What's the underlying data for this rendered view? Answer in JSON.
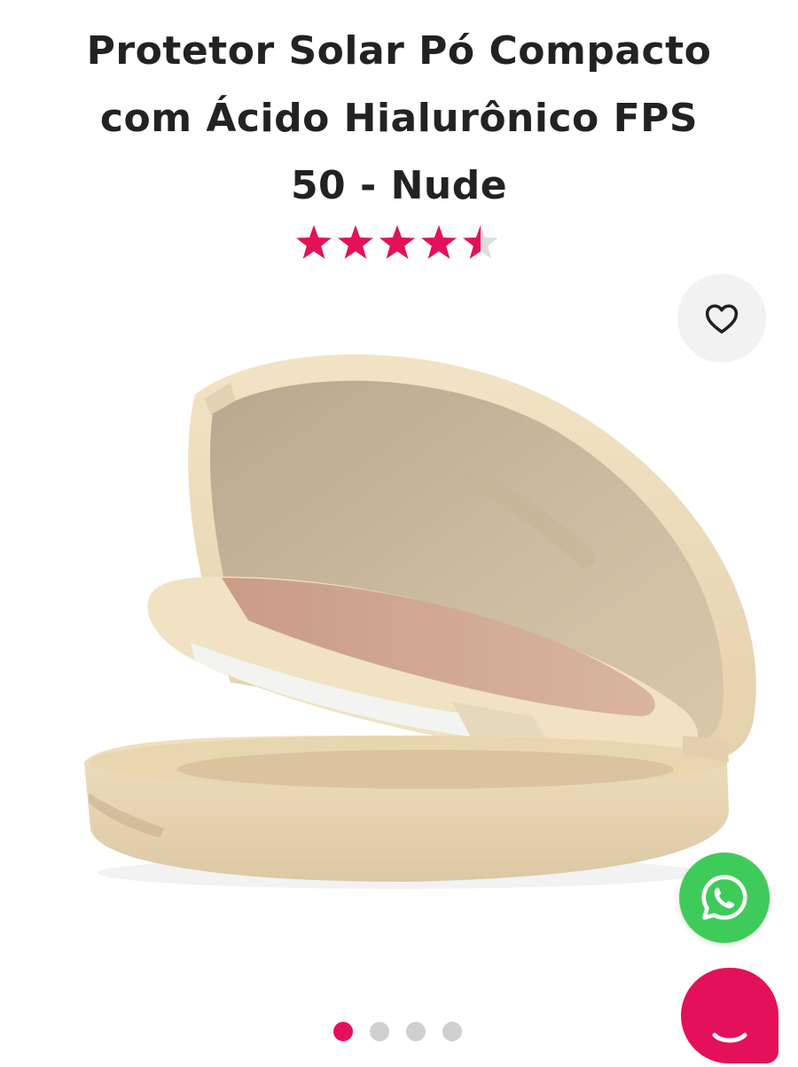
{
  "product": {
    "title_line1": "Protetor Solar Pó Compacto",
    "title_line2": "com Ácido Hialurônico FPS",
    "title_line3": "50 - Nude"
  },
  "rating": {
    "value": 4.5,
    "max": 5,
    "star_color": "#e5105a",
    "empty_color": "#dddddd"
  },
  "icons": {
    "favorite": "heart-outline-icon",
    "whatsapp": "whatsapp-icon",
    "chat": "chat-bubble-icon"
  },
  "carousel": {
    "total": 4,
    "active_index": 0
  },
  "colors": {
    "accent": "#e5105a",
    "whatsapp": "#3fcb5a",
    "title": "#222222"
  }
}
